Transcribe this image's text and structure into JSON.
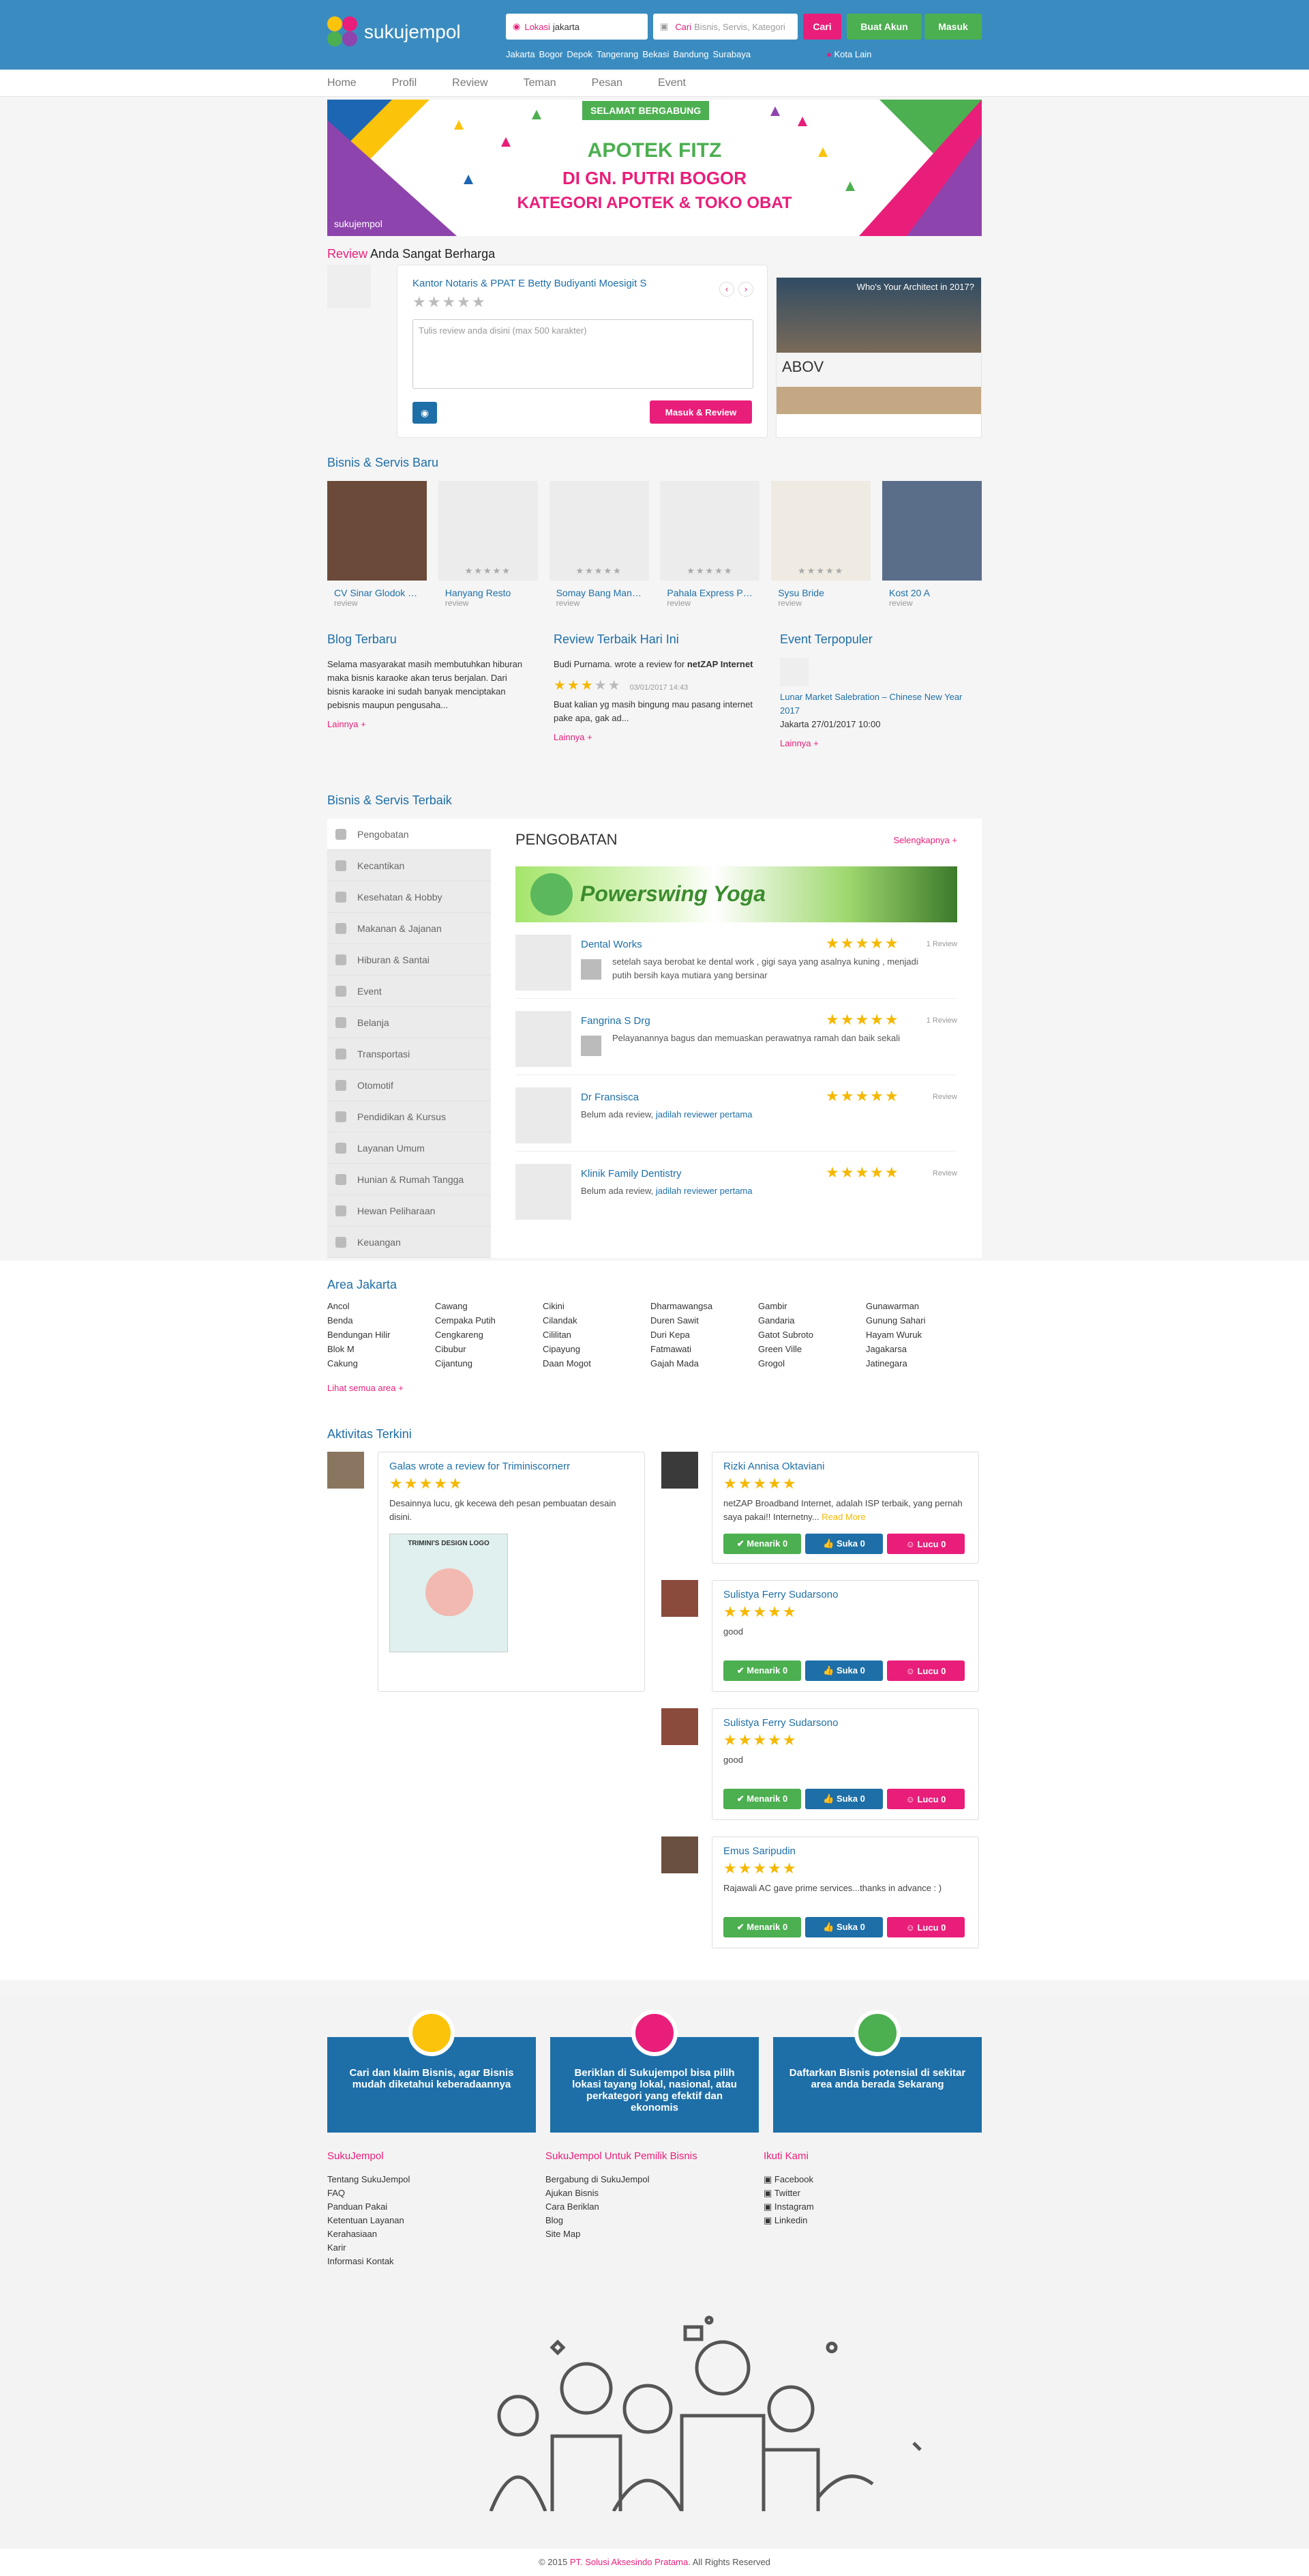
{
  "header": {
    "logo_text": "sukujempol",
    "location_label": "Lokasi",
    "location_value": "jakarta",
    "search_label": "Cari",
    "search_placeholder": "Bisnis, Servis, Kategori",
    "search_button": "Cari",
    "register_button": "Buat Akun",
    "login_button": "Masuk",
    "cities": [
      "Jakarta",
      "Bogor",
      "Depok",
      "Tangerang",
      "Bekasi",
      "Bandung",
      "Surabaya"
    ],
    "other_city": "Kota Lain"
  },
  "subnav": [
    "Home",
    "Profil",
    "Review",
    "Teman",
    "Pesan",
    "Event"
  ],
  "banner": {
    "tag": "SELAMAT BERGABUNG",
    "line1": "APOTEK FITZ",
    "line2": "DI GN. PUTRI BOGOR",
    "line3": "KATEGORI APOTEK & TOKO OBAT",
    "logo": "sukujempol"
  },
  "review_section": {
    "title_accent": "Review",
    "title_rest": "Anda Sangat Berharga",
    "business": "Kantor Notaris & PPAT E Betty Budiyanti Moesigit S",
    "placeholder": "Tulis review anda disini (max 500 karakter)",
    "submit": "Masuk & Review",
    "ad_title": "Who's Your Architect in 2017?",
    "ad_brand": "ABOV"
  },
  "new_business": {
    "title": "Bisnis & Servis Baru",
    "items": [
      {
        "name": "CV Sinar Glodok L...",
        "sub": "review"
      },
      {
        "name": "Hanyang Resto",
        "sub": "review"
      },
      {
        "name": "Somay Bang Mand...",
        "sub": "review"
      },
      {
        "name": "Pahala Express Pa...",
        "sub": "review"
      },
      {
        "name": "Sysu Bride",
        "sub": "review"
      },
      {
        "name": "Kost 20 A",
        "sub": "review"
      }
    ]
  },
  "blog": {
    "title": "Blog Terbaru",
    "text": "Selama masyarakat masih membutuhkan hiburan maka bisnis karaoke akan terus berjalan. Dari bisnis karaoke ini sudah banyak menciptakan pebisnis maupun pengusaha...",
    "more": "Lainnya +"
  },
  "best_review": {
    "title": "Review Terbaik Hari Ini",
    "author": "Budi Purnama.",
    "action": "wrote a review for",
    "target": "netZAP Internet",
    "date": "03/01/2017 14:43",
    "text": "Buat kalian yg masih bingung mau pasang internet pake apa, gak ad...",
    "more": "Lainnya +"
  },
  "event": {
    "title": "Event Terpopuler",
    "name": "Lunar Market Salebration – Chinese New Year 2017",
    "meta": "Jakarta 27/01/2017 10:00",
    "more": "Lainnya +"
  },
  "best_business": {
    "title": "Bisnis & Servis Terbaik",
    "categories": [
      "Pengobatan",
      "Kecantikan",
      "Kesehatan & Hobby",
      "Makanan & Jajanan",
      "Hiburan & Santai",
      "Event",
      "Belanja",
      "Transportasi",
      "Otomotif",
      "Pendidikan & Kursus",
      "Layanan Umum",
      "Hunian & Rumah Tangga",
      "Hewan Peliharaan",
      "Keuangan"
    ],
    "panel_title": "PENGOBATAN",
    "panel_more": "Selengkapnya +",
    "promo": "Powerswing Yoga",
    "entries": [
      {
        "name": "Dental Works",
        "review": "1 Review",
        "text": "setelah saya berobat ke dental work , gigi saya yang asalnya kuning , menjadi putih bersih kaya mutiara yang bersinar"
      },
      {
        "name": "Fangrina S Drg",
        "review": "1 Review",
        "text": "Pelayanannya bagus dan memuaskan perawatnya ramah dan baik sekali"
      },
      {
        "name": "Dr Fransisca",
        "review": "Review",
        "empty": "Belum ada review,",
        "link": "jadilah reviewer pertama"
      },
      {
        "name": "Klinik Family Dentistry",
        "review": "Review",
        "empty": "Belum ada review,",
        "link": "jadilah reviewer pertama"
      }
    ]
  },
  "area": {
    "title": "Area Jakarta",
    "columns": [
      [
        "Ancol",
        "Benda",
        "Bendungan Hilir",
        "Blok M",
        "Cakung"
      ],
      [
        "Cawang",
        "Cempaka Putih",
        "Cengkareng",
        "Cibubur",
        "Cijantung"
      ],
      [
        "Cikini",
        "Cilandak",
        "Cililitan",
        "Cipayung",
        "Daan Mogot"
      ],
      [
        "Dharmawangsa",
        "Duren Sawit",
        "Duri Kepa",
        "Fatmawati",
        "Gajah Mada"
      ],
      [
        "Gambir",
        "Gandaria",
        "Gatot Subroto",
        "Green Ville",
        "Grogol"
      ],
      [
        "Gunawarman",
        "Gunung Sahari",
        "Hayam Wuruk",
        "Jagakarsa",
        "Jatinegara"
      ]
    ],
    "more": "Lihat semua area +"
  },
  "activity": {
    "title": "Aktivitas Terkini",
    "left": {
      "name": "Galas wrote a review for Triminiscornerr",
      "text": "Desainnya lucu, gk kecewa deh pesan pembuatan desain disini.",
      "img_label": "TRIMINI'S DESIGN LOGO"
    },
    "right": [
      {
        "name": "Rizki Annisa Oktaviani",
        "text": "netZAP Broadband Internet, adalah ISP terbaik, yang pernah saya pakai!! Internetny...",
        "read": "Read More"
      },
      {
        "name": "Sulistya Ferry Sudarsono",
        "text": "good"
      },
      {
        "name": "Sulistya Ferry Sudarsono",
        "text": "good"
      },
      {
        "name": "Emus Saripudin",
        "text": "Rajawali AC gave prime services...thanks in advance : )"
      }
    ],
    "btn_menarik": "Menarik",
    "btn_suka": "Suka",
    "btn_lucu": "Lucu",
    "count": "0"
  },
  "footer": {
    "tiles": [
      "Cari dan klaim Bisnis, agar Bisnis mudah diketahui keberadaannya",
      "Beriklan di Sukujempol bisa pilih lokasi tayang lokal, nasional, atau perkategori yang efektif dan ekonomis",
      "Daftarkan Bisnis potensial di sekitar area anda berada Sekarang"
    ],
    "col1_title": "SukuJempol",
    "col1": [
      "Tentang SukuJempol",
      "FAQ",
      "Panduan Pakai",
      "Ketentuan Layanan",
      "Kerahasiaan",
      "Karir",
      "Informasi Kontak"
    ],
    "col2_title": "SukuJempol Untuk Pemilik Bisnis",
    "col2": [
      "Bergabung di SukuJempol",
      "Ajukan Bisnis",
      "Cara Beriklan",
      "Blog",
      "Site Map"
    ],
    "col3_title": "Ikuti Kami",
    "col3": [
      "Facebook",
      "Twitter",
      "Instagram",
      "Linkedin"
    ],
    "copy_pre": "© 2015",
    "copy_co": "PT. Solusi Aksesindo Pratama",
    "copy_post": ". All Rights Reserved"
  },
  "colors": {
    "header": "#3a8cc0",
    "accent": "#e91e7a",
    "green": "#4caf50",
    "link": "#1e6fa8"
  }
}
